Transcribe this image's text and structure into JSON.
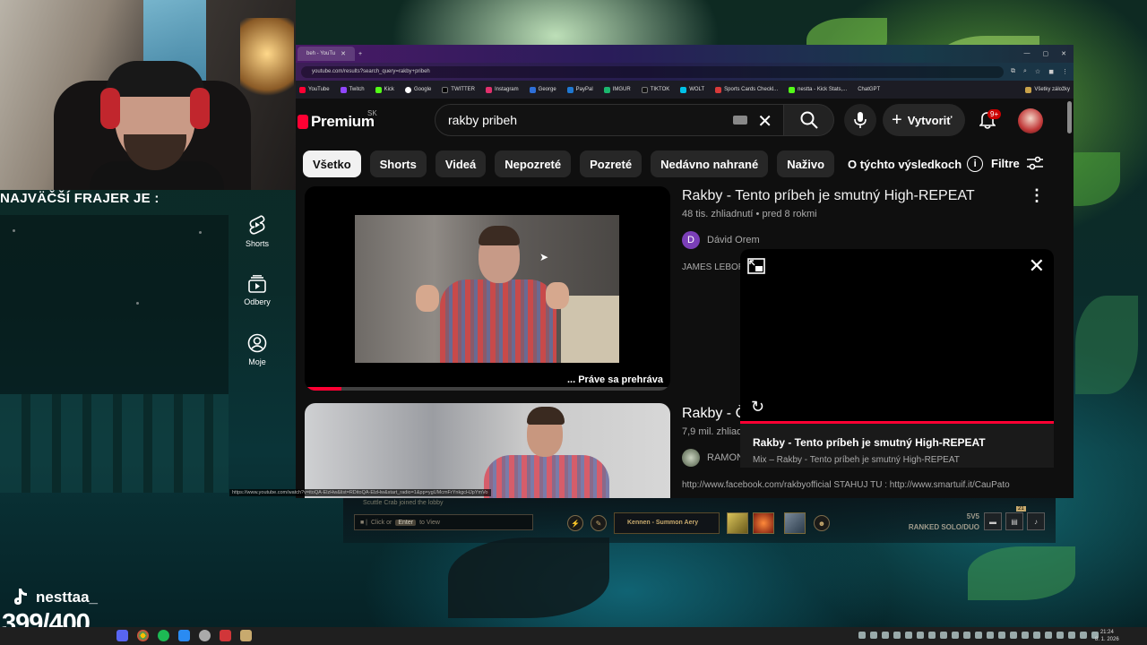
{
  "overlay": {
    "caption": "NAJVÄČŠÍ FRAJER JE :",
    "tiktok_handle": "nesttaa_",
    "counter": "399/400"
  },
  "browser": {
    "tab_title": "beh - YouTu",
    "url": "youtube.com/results?search_query=rakby+pribeh",
    "bookmarks": [
      "YouTube",
      "Twitch",
      "Kick",
      "Google",
      "TWITTER",
      "Instagram",
      "George",
      "PayPal",
      "IMGUR",
      "TIKTOK",
      "WOLT",
      "Sports Cards Checkl...",
      "nestta - Kick Stats,...",
      "ChatGPT"
    ],
    "all_bookmarks": "Všetky záložky",
    "status_url": "https://www.youtube.com/watch?v=itoQA-ElzHw&list=RDitoQA-ElzHw&start_radio=1&pp=ygUMcmFrYnkgcHJpYmVo"
  },
  "youtube": {
    "logo_text": "Premium",
    "region": "SK",
    "search_value": "rakby pribeh",
    "create_label": "Vytvoriť",
    "notif_count": "9+",
    "chips": [
      "Všetko",
      "Shorts",
      "Videá",
      "Nepozreté",
      "Pozreté",
      "Nedávno nahrané",
      "Naživo"
    ],
    "about_results": "O týchto výsledkoch",
    "filters": "Filtre",
    "sidebar": [
      {
        "label": "Shorts",
        "icon": "shorts-icon"
      },
      {
        "label": "Odbery",
        "icon": "subscriptions-icon"
      },
      {
        "label": "Moje",
        "icon": "you-icon"
      }
    ],
    "results": [
      {
        "title": "Rakby - Tento príbeh je smutný High-REPEAT",
        "meta": "48 tis. zhliadnutí • pred 8 rokmi",
        "channel_initial": "D",
        "channel": "Dávid Orem",
        "description": "JAMES LEBOR",
        "overlay_label": "... Práve sa prehráva"
      },
      {
        "title": "Rakby - Č",
        "meta": "7,9 mil. zhliad",
        "channel": "RAMON",
        "description": "http://www.facebook.com/rakbyofficial STAHUJ TU : http://www.smartuif.it/CauPato"
      }
    ],
    "miniplayer": {
      "title": "Rakby - Tento príbeh je smutný High-REPEAT",
      "subtitle": "Mix – Rakby - Tento príbeh je smutný High-REPEAT"
    }
  },
  "game": {
    "lobby_message": "Scuttle Crab joined the lobby",
    "chat_prefix": "Click or",
    "chat_key": "Enter",
    "chat_suffix": "to View",
    "summoner": "Kennen - Summon Aery",
    "mode_size": "5V5",
    "mode_name": "RANKED SOLO/DUO",
    "badge": "21"
  },
  "taskbar": {
    "time": "21:24",
    "date": "8. 1. 2026"
  }
}
